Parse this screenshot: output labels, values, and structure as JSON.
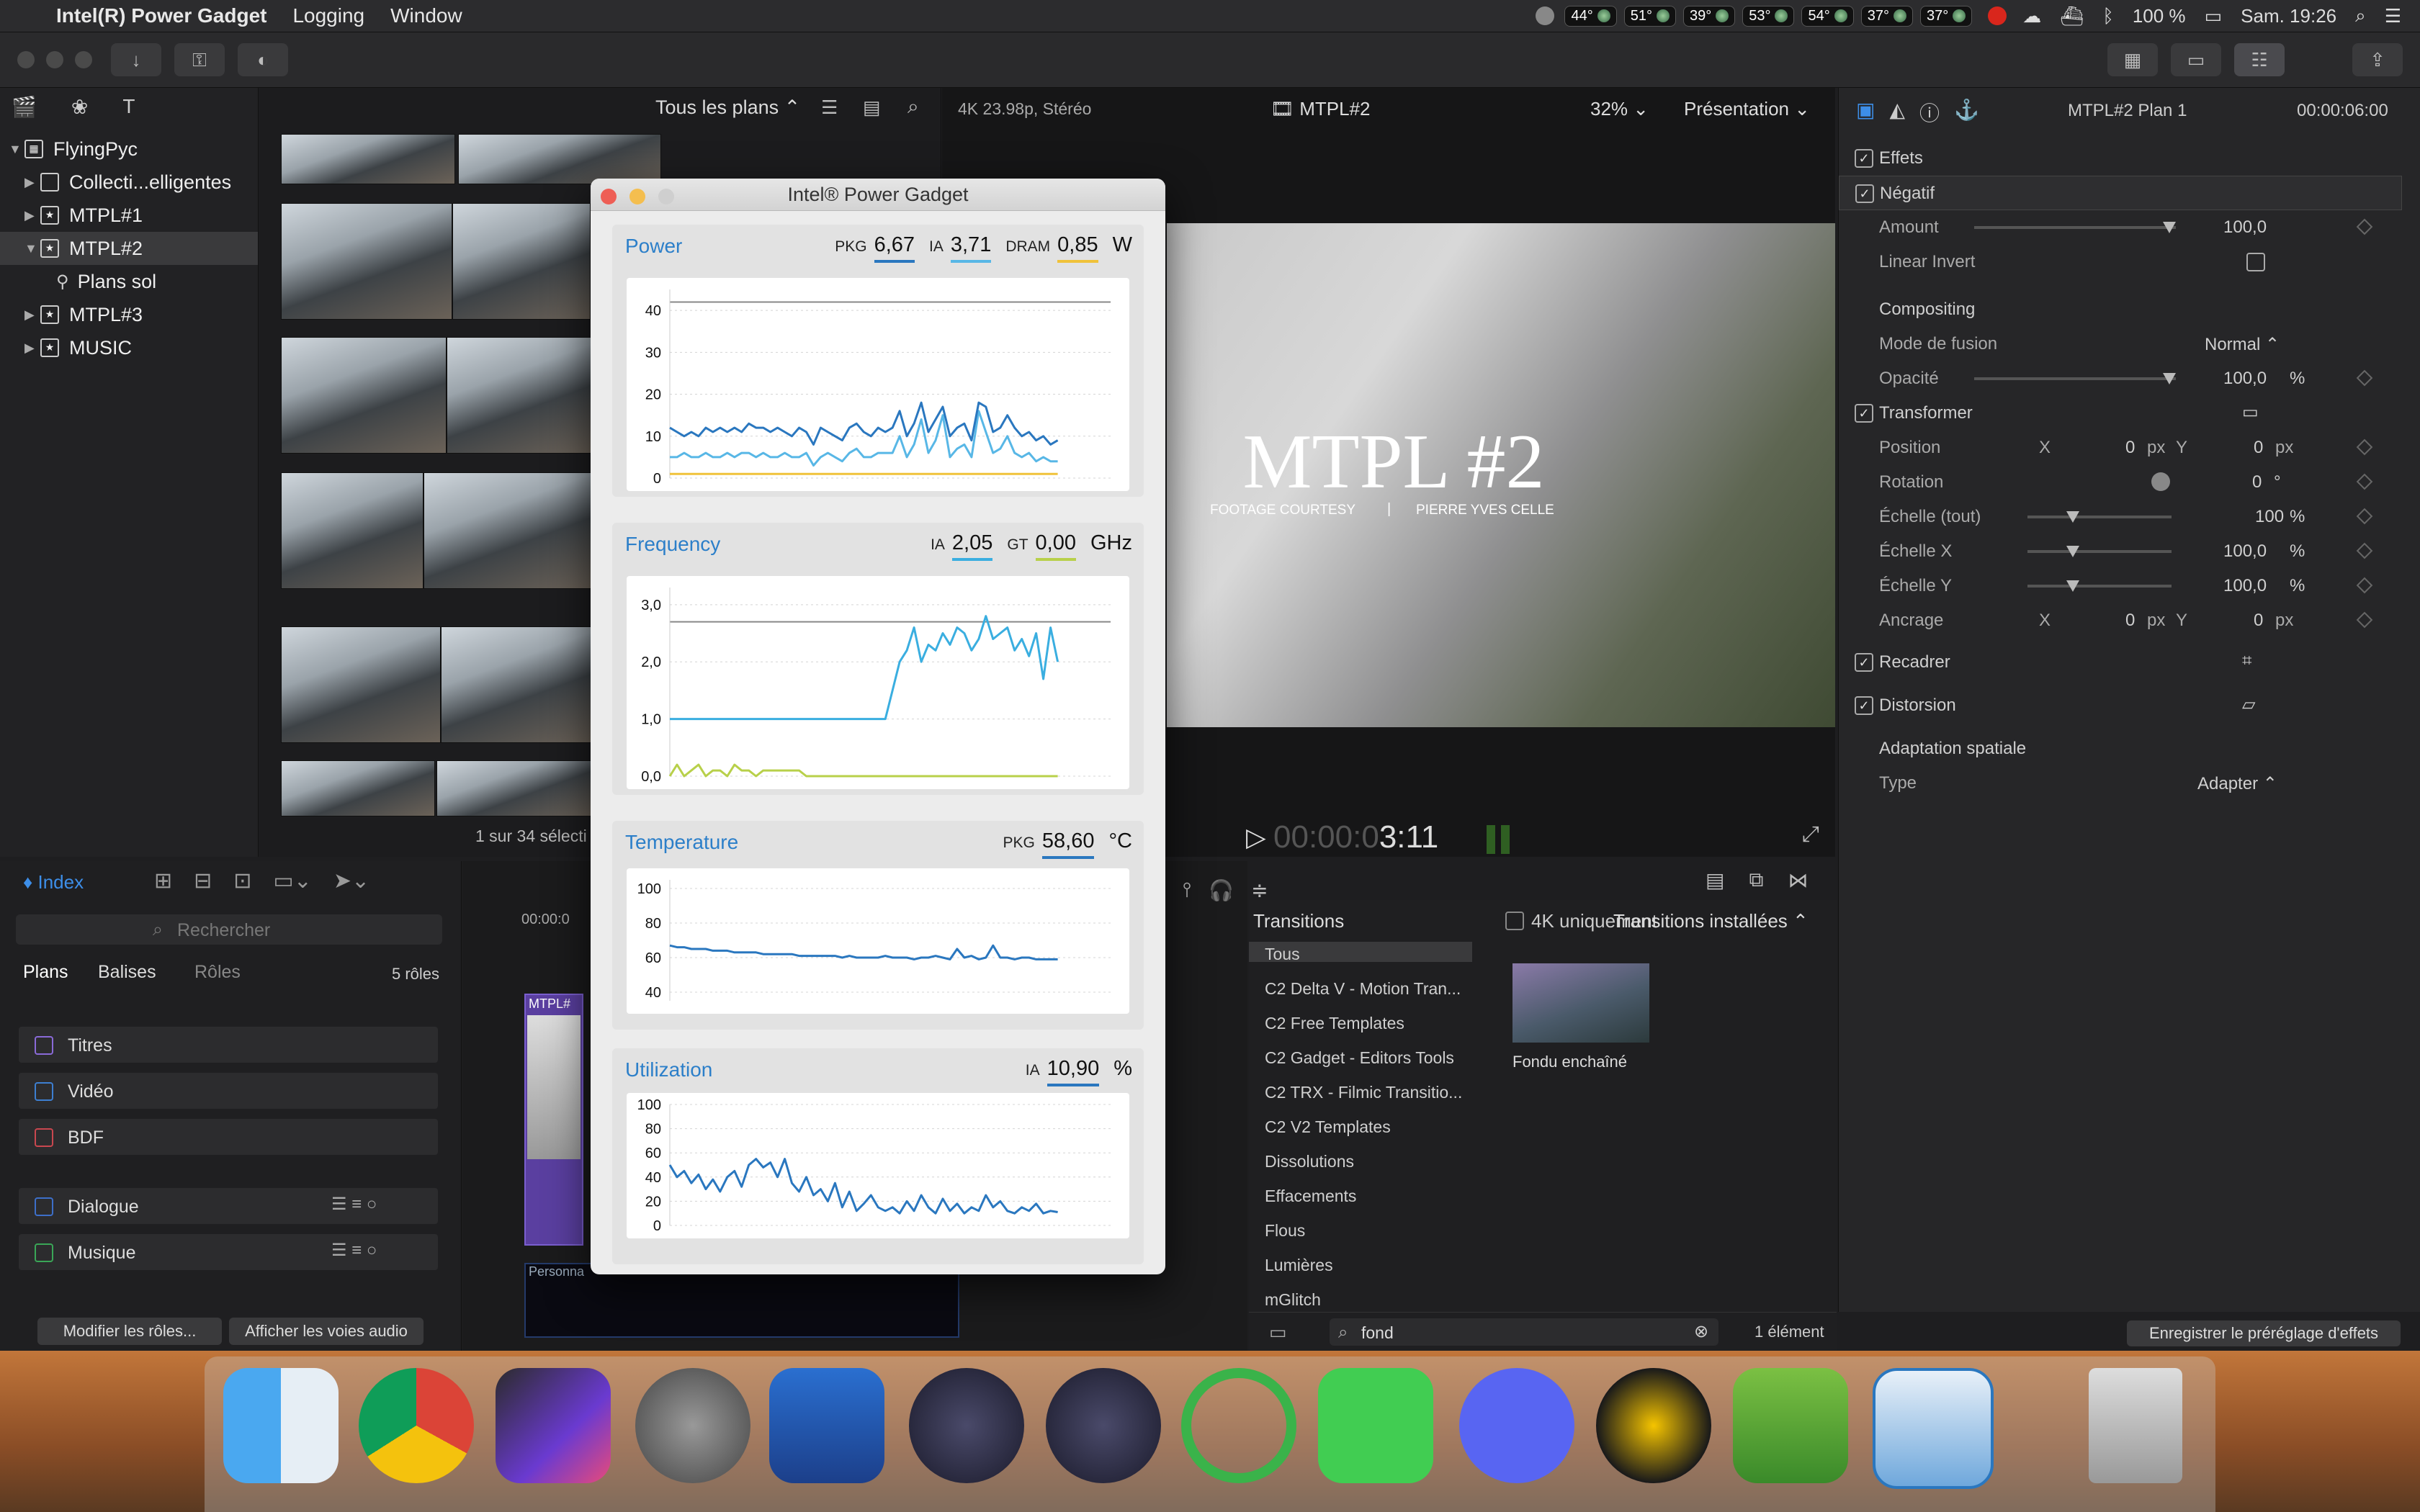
{
  "menubar": {
    "app_name": "Intel(R) Power Gadget",
    "menus": [
      "Logging",
      "Window"
    ],
    "sensors": [
      "44°",
      "51°",
      "39°",
      "53°",
      "54°",
      "37°",
      "37°"
    ],
    "battery": "100 %",
    "clock": "Sam. 19:26"
  },
  "library": {
    "items": [
      {
        "label": "FlyingPyc",
        "icon": "library-icon"
      },
      {
        "label": "Collecti...elligentes",
        "icon": "folder-icon"
      },
      {
        "label": "MTPL#1",
        "icon": "event-star-icon"
      },
      {
        "label": "MTPL#2",
        "icon": "event-star-icon"
      },
      {
        "label": "Plans sol",
        "icon": "keyword-icon"
      },
      {
        "label": "MTPL#3",
        "icon": "event-star-icon"
      },
      {
        "label": "MUSIC",
        "icon": "event-star-icon"
      }
    ]
  },
  "browser": {
    "filter": "Tous les plans",
    "status": "1 sur 34 sélecti"
  },
  "viewer": {
    "format": "4K 23.98p, Stéréo",
    "project": "MTPL#2",
    "zoom": "32%",
    "view_menu": "Présentation",
    "title_main": "MTPL #2",
    "title_left": "FOOTAGE COURTESY",
    "title_sep": "|",
    "title_right": "PIERRE YVES CELLE",
    "timecode_dim": "00:00:0",
    "timecode": "3:11"
  },
  "inspector": {
    "clip": "MTPL#2 Plan 1",
    "duration": "00:00:06:00",
    "effets": "Effets",
    "negatif": "Négatif",
    "amount_label": "Amount",
    "amount_value": "100,0",
    "linear_invert": "Linear Invert",
    "compositing": "Compositing",
    "fusion_label": "Mode de fusion",
    "fusion_value": "Normal",
    "opacite_label": "Opacité",
    "opacite_value": "100,0",
    "percent": "%",
    "transformer": "Transformer",
    "position": "Position",
    "x": "X",
    "y": "Y",
    "pos_x": "0",
    "pos_y": "0",
    "px": "px",
    "rotation": "Rotation",
    "rotation_value": "0",
    "deg": "°",
    "echelle_tout": "Échelle (tout)",
    "echelle_tout_value": "100",
    "echelle_x": "Échelle X",
    "echelle_x_value": "100,0",
    "echelle_y": "Échelle Y",
    "echelle_y_value": "100,0",
    "ancrage": "Ancrage",
    "anc_x": "0",
    "anc_y": "0",
    "recadrer": "Recadrer",
    "distorsion": "Distorsion",
    "adaptation": "Adaptation spatiale",
    "type_label": "Type",
    "type_value": "Adapter",
    "save_preset": "Enregistrer le préréglage d'effets"
  },
  "timeline_index": {
    "tab": "Index",
    "search_placeholder": "Rechercher",
    "tabs": [
      "Plans",
      "Balises",
      "Rôles"
    ],
    "roles_count": "5 rôles",
    "roles": [
      {
        "label": "Titres",
        "color": "#8a6ad8",
        "checked": true
      },
      {
        "label": "Vidéo",
        "color": "#3d7fd1",
        "checked": true
      },
      {
        "label": "BDF",
        "color": "#c9474f",
        "checked": true
      },
      {
        "label": "Dialogue",
        "color": "#3d6fc9",
        "checked": false
      },
      {
        "label": "Musique",
        "color": "#3aa657",
        "checked": true
      }
    ],
    "modify_roles": "Modifier les rôles...",
    "show_lanes": "Afficher les voies audio"
  },
  "timeline": {
    "ruler_start": "00:00:0",
    "clip_label": "MTPL#",
    "lane_label": "Personna"
  },
  "transitions": {
    "header": "Transitions",
    "filter_label": "4K uniquement",
    "installed": "Transitions installées",
    "categories": [
      "Tous",
      "C2 Delta V - Motion Tran...",
      "C2 Free Templates",
      "C2 Gadget - Editors Tools",
      "C2 TRX - Filmic Transitio...",
      "C2 V2 Templates",
      "Dissolutions",
      "Effacements",
      "Flous",
      "Lumières",
      "mGlitch"
    ],
    "item": "Fondu enchaîné",
    "search_value": "fond",
    "count": "1 élément"
  },
  "power_gadget": {
    "title": "Intel® Power Gadget",
    "power": {
      "heading": "Power",
      "pkg_label": "PKG",
      "pkg": "6,67",
      "ia_label": "IA",
      "ia": "3,71",
      "dram_label": "DRAM",
      "dram": "0,85",
      "unit": "W",
      "colors": {
        "pkg": "#2a77bf",
        "ia": "#58b7e6",
        "dram": "#f0c23a"
      }
    },
    "frequency": {
      "heading": "Frequency",
      "ia_label": "IA",
      "ia": "2,05",
      "gt_label": "GT",
      "gt": "0,00",
      "unit": "GHz",
      "colors": {
        "ia": "#3aaee0",
        "gt": "#b8d04a"
      }
    },
    "temperature": {
      "heading": "Temperature",
      "pkg_label": "PKG",
      "pkg": "58,60",
      "unit": "°C"
    },
    "utilization": {
      "heading": "Utilization",
      "ia_label": "IA",
      "ia": "10,90",
      "unit": "%"
    }
  },
  "chart_data": [
    {
      "type": "line",
      "title": "Power",
      "ylim": [
        0,
        45
      ],
      "yticks": [
        0,
        10,
        20,
        30,
        40
      ],
      "reference_line": 42,
      "series": [
        {
          "name": "PKG",
          "values": [
            12,
            11,
            10,
            11,
            10,
            12,
            11,
            12,
            11,
            12,
            11,
            13,
            12,
            12,
            11,
            12,
            11,
            10,
            12,
            11,
            8,
            12,
            11,
            10,
            9,
            12,
            13,
            11,
            10,
            12,
            11,
            12,
            16,
            10,
            13,
            18,
            11,
            14,
            17,
            10,
            12,
            13,
            9,
            18,
            17,
            11,
            12,
            15,
            12,
            10,
            11,
            9,
            10,
            8,
            9
          ]
        },
        {
          "name": "IA",
          "values": [
            5,
            5,
            6,
            5,
            5,
            6,
            5,
            5,
            6,
            5,
            6,
            6,
            5,
            6,
            5,
            5,
            6,
            5,
            5,
            6,
            3,
            5,
            6,
            5,
            4,
            6,
            7,
            5,
            5,
            6,
            6,
            6,
            10,
            5,
            8,
            14,
            6,
            9,
            15,
            5,
            7,
            8,
            5,
            16,
            11,
            6,
            7,
            10,
            6,
            5,
            6,
            4,
            5,
            4,
            4
          ]
        },
        {
          "name": "DRAM",
          "values": [
            1,
            1,
            1,
            1,
            1,
            1,
            1,
            1,
            1,
            1,
            1,
            1,
            1,
            1,
            1,
            1,
            1,
            1,
            1,
            1,
            1,
            1,
            1,
            1,
            1,
            1,
            1,
            1,
            1,
            1,
            1,
            1,
            1,
            1,
            1,
            1,
            1,
            1,
            1,
            1,
            1,
            1,
            1,
            1,
            1,
            1,
            1,
            1,
            1,
            1,
            1,
            1,
            1,
            1,
            1
          ]
        }
      ]
    },
    {
      "type": "line",
      "title": "Frequency",
      "ylim": [
        0,
        3.3
      ],
      "yticks": [
        "0,0",
        "1,0",
        "2,0",
        "3,0"
      ],
      "reference_line": 2.7,
      "series": [
        {
          "name": "IA",
          "values": [
            1.0,
            1.0,
            1.0,
            1.0,
            1.0,
            1.0,
            1.0,
            1.0,
            1.0,
            1.0,
            1.0,
            1.0,
            1.0,
            1.0,
            1.0,
            1.0,
            1.0,
            1.0,
            1.0,
            1.0,
            1.0,
            1.0,
            1.0,
            1.0,
            1.0,
            1.0,
            1.0,
            1.0,
            1.0,
            1.0,
            1.0,
            1.5,
            2.0,
            2.2,
            2.6,
            2.0,
            2.3,
            2.2,
            2.5,
            2.3,
            2.6,
            2.5,
            2.2,
            2.4,
            2.8,
            2.4,
            2.5,
            2.6,
            2.2,
            2.4,
            2.1,
            2.5,
            1.7,
            2.6,
            2.0
          ]
        },
        {
          "name": "GT",
          "values": [
            0.0,
            0.2,
            0.0,
            0.1,
            0.2,
            0.0,
            0.1,
            0.1,
            0.0,
            0.2,
            0.1,
            0.1,
            0.0,
            0.1,
            0.1,
            0.1,
            0.1,
            0.1,
            0.1,
            0.0,
            0.0,
            0.0,
            0.0,
            0.0,
            0.0,
            0.0,
            0.0,
            0.0,
            0.0,
            0.0,
            0.0,
            0.0,
            0.0,
            0.0,
            0.0,
            0.0,
            0.0,
            0.0,
            0.0,
            0.0,
            0.0,
            0.0,
            0.0,
            0.0,
            0.0,
            0.0,
            0.0,
            0.0,
            0.0,
            0.0,
            0.0,
            0.0,
            0.0,
            0.0,
            0.0
          ]
        }
      ]
    },
    {
      "type": "line",
      "title": "Temperature",
      "ylim": [
        35,
        105
      ],
      "yticks": [
        40,
        60,
        80,
        100
      ],
      "series": [
        {
          "name": "PKG",
          "values": [
            67,
            66,
            66,
            65,
            65,
            65,
            64,
            64,
            64,
            63,
            63,
            63,
            63,
            62,
            62,
            62,
            62,
            62,
            61,
            61,
            61,
            61,
            61,
            61,
            60,
            61,
            60,
            60,
            60,
            60,
            61,
            60,
            60,
            60,
            59,
            60,
            60,
            61,
            60,
            59,
            65,
            60,
            61,
            59,
            60,
            67,
            60,
            60,
            59,
            60,
            60,
            59,
            59,
            59,
            59
          ]
        }
      ]
    },
    {
      "type": "line",
      "title": "Utilization",
      "ylim": [
        0,
        100
      ],
      "yticks": [
        0,
        20,
        40,
        60,
        80,
        100
      ],
      "series": [
        {
          "name": "IA",
          "values": [
            50,
            40,
            45,
            35,
            42,
            30,
            38,
            28,
            40,
            45,
            32,
            50,
            55,
            48,
            52,
            40,
            55,
            35,
            28,
            40,
            25,
            30,
            20,
            35,
            15,
            28,
            12,
            18,
            25,
            15,
            12,
            15,
            10,
            20,
            12,
            25,
            15,
            10,
            22,
            12,
            18,
            10,
            15,
            12,
            25,
            15,
            20,
            12,
            10,
            15,
            12,
            18,
            10,
            12,
            11
          ]
        }
      ]
    }
  ]
}
